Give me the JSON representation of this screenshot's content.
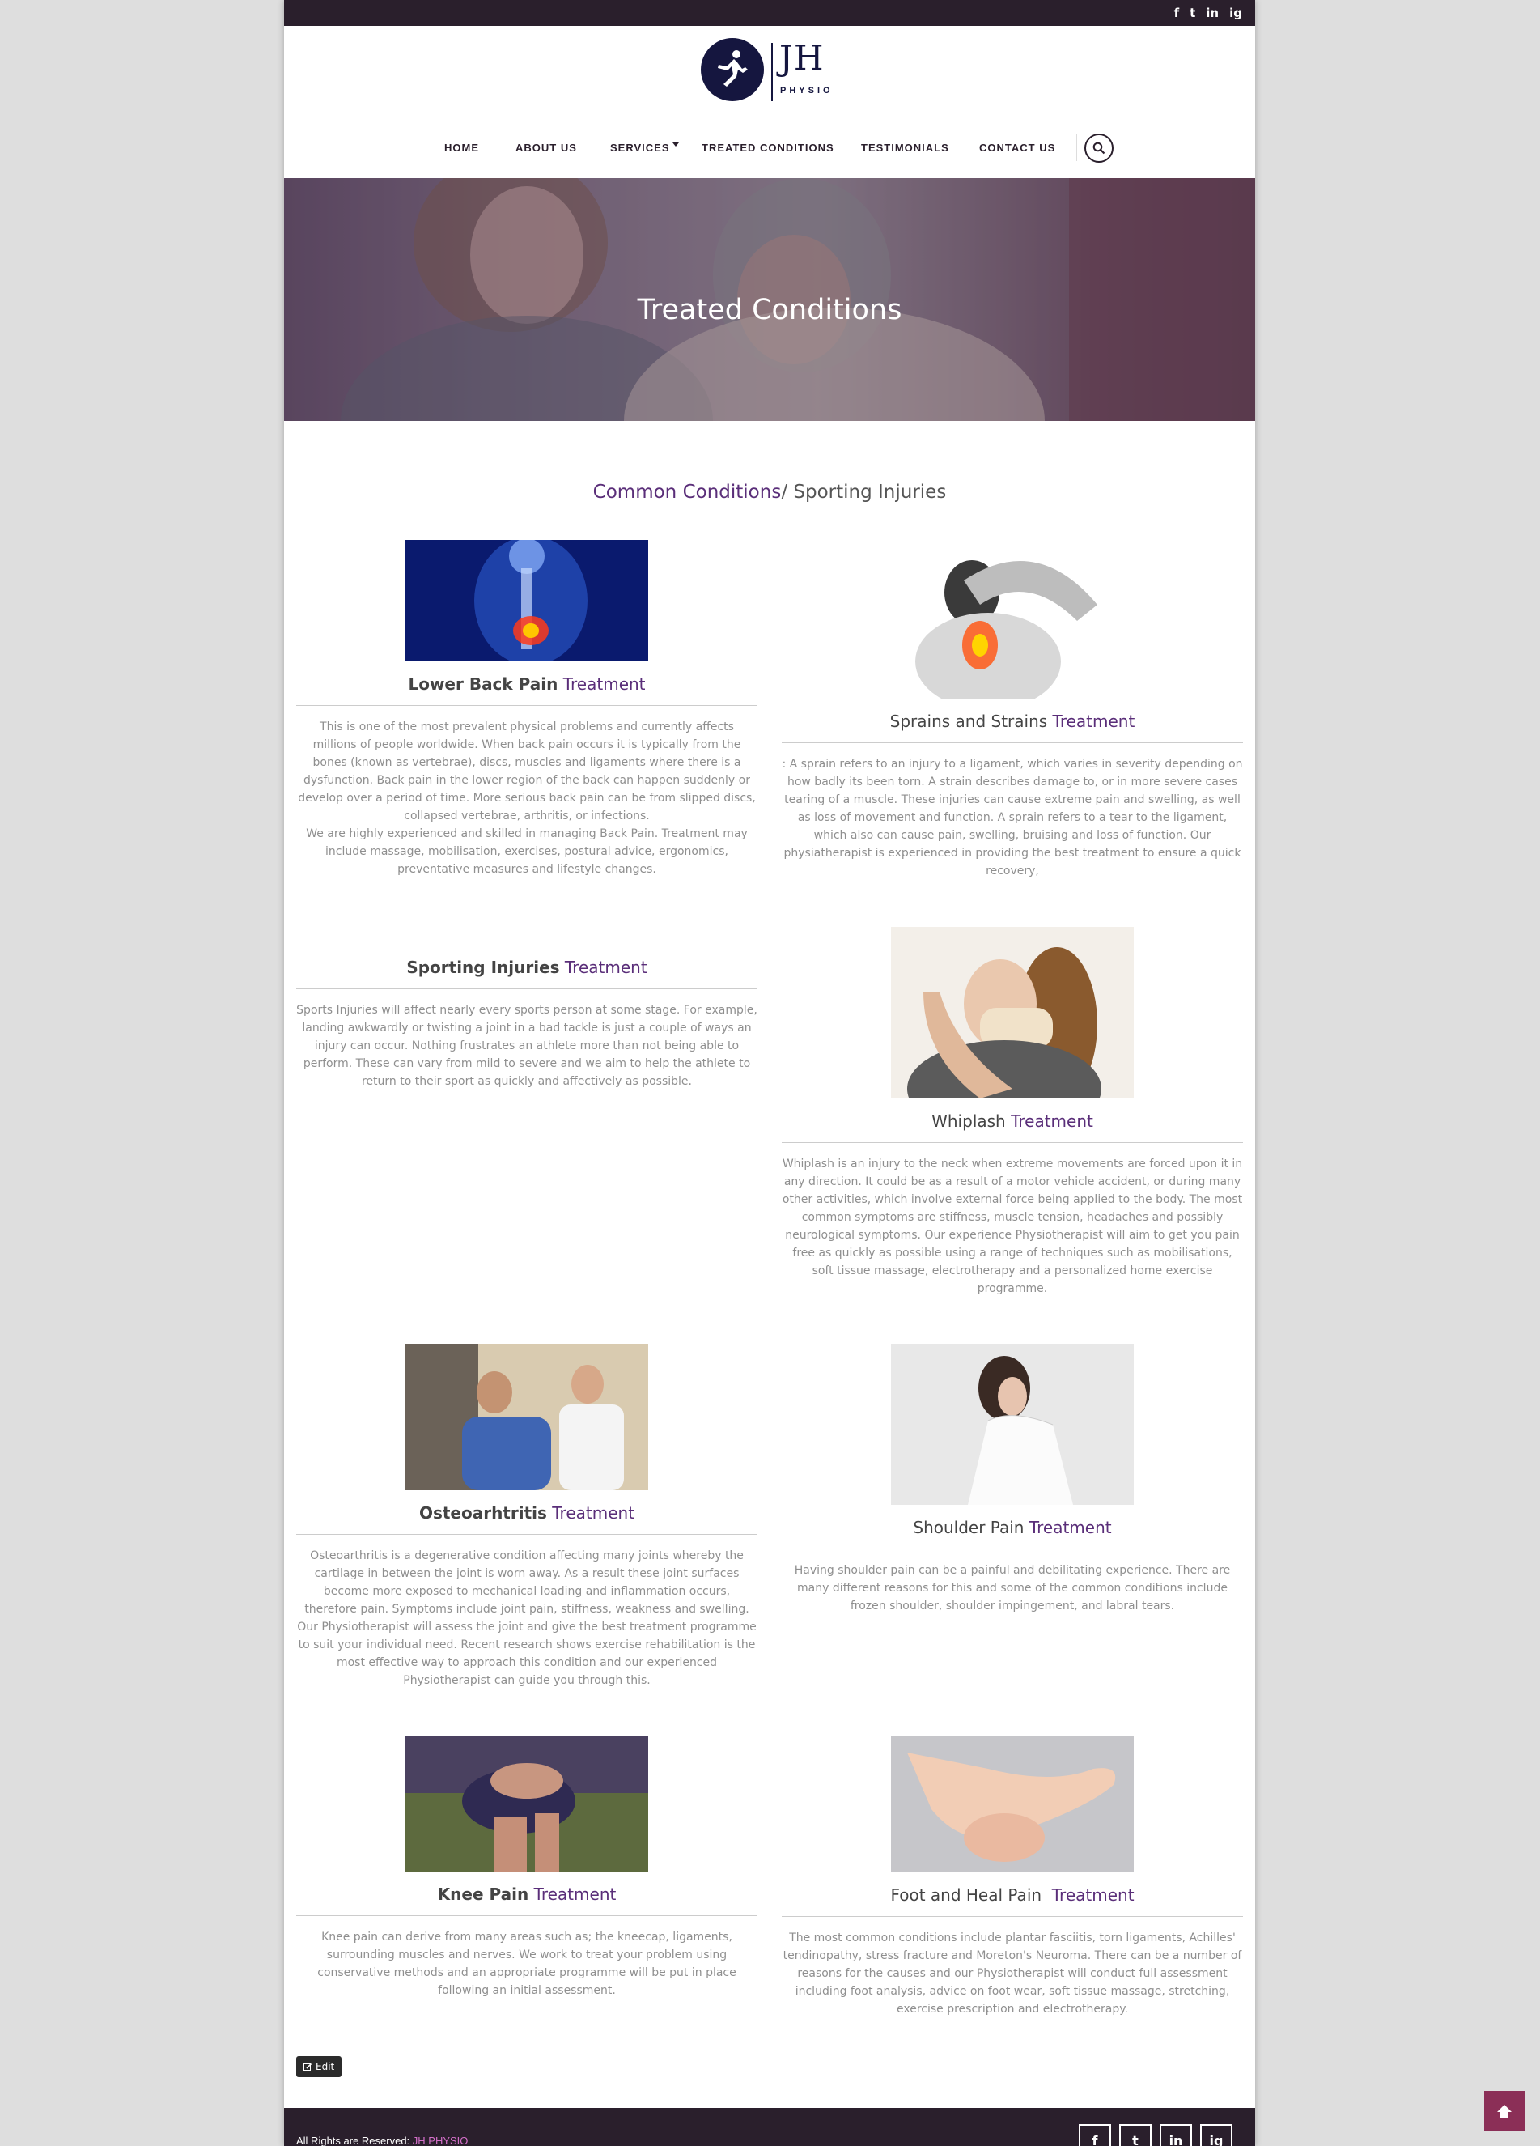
{
  "topbar": {
    "social": [
      "f",
      "t",
      "in",
      "ig"
    ]
  },
  "logo": {
    "jh": "JH",
    "physio": "PHYSIO"
  },
  "nav": {
    "home": "HOME",
    "about": "ABOUT US",
    "services": "SERVICES",
    "treated": "TREATED CONDITIONS",
    "testimonials": "TESTIMONIALS",
    "contact": "CONTACT US"
  },
  "hero": {
    "title": "Treated Conditions"
  },
  "section": {
    "accent": "Common Conditions",
    "rest": "/ Sporting Injuries"
  },
  "conditions": [
    {
      "name": "Lower Back Pain",
      "treatment": "Treatment",
      "desc": "This is one of the most prevalent physical problems and currently affects millions of people worldwide. When back pain occurs it is typically from the bones (known as vertebrae), discs, muscles and ligaments where there is a dysfunction. Back pain in the lower region of the back can happen suddenly or develop over a period of time. More serious back pain can be from slipped discs, collapsed vertebrae, arthritis, or infections.",
      "desc2": "We are highly experienced and skilled in managing Back Pain. Treatment may include massage, mobilisation, exercises, postural advice, ergonomics, preventative measures and lifestyle changes."
    },
    {
      "name": "Sprains and Strains",
      "treatment": "Treatment",
      "desc": ": A sprain refers to an injury to a ligament, which varies in severity depending on how badly its been torn. A strain describes damage to, or in more severe cases tearing of a muscle. These injuries can cause extreme pain and swelling, as well as loss of movement and function. A sprain refers to a tear to the ligament, which also can cause pain, swelling, bruising and loss of function. Our physiatherapist is experienced in providing the best treatment to ensure a quick recovery,"
    },
    {
      "name": "Sporting Injuries",
      "treatment": "Treatment",
      "desc": "Sports Injuries will affect nearly every sports person at some stage. For example, landing awkwardly or twisting a joint in a bad tackle is just a couple of ways an injury can occur. Nothing frustrates an athlete more than not being able to perform. These can vary from mild to severe and we aim to help the athlete to return to their sport as quickly and affectively as possible."
    },
    {
      "name": "Whiplash",
      "treatment": "Treatment",
      "desc": "Whiplash is an injury to the neck when extreme movements are forced upon it in any direction. It could be as a result of a motor vehicle accident, or during many other activities, which involve external force being applied to the body. The most common symptoms are stiffness, muscle tension, headaches and possibly neurological symptoms. Our experience Physiotherapist will aim to get you pain free as quickly as possible using a range of techniques such as mobilisations, soft tissue massage, electrotherapy and a personalized home exercise programme."
    },
    {
      "name": "Osteoarhtritis",
      "treatment": "Treatment",
      "desc": "Osteoarthritis is a degenerative condition affecting many joints whereby the cartilage in between the joint is worn away. As a result these joint surfaces become more exposed to mechanical loading and inflammation occurs, therefore pain. Symptoms include joint pain, stiffness, weakness and swelling. Our Physiotherapist will assess the joint and give the best treatment programme to suit your individual need. Recent research shows exercise rehabilitation is the most effective way to approach this condition and our experienced Physiotherapist can guide you through this."
    },
    {
      "name": "Shoulder Pain",
      "treatment": "Treatment",
      "desc": "Having shoulder pain can be a painful and debilitating experience. There are many different reasons for this and some of the common conditions include frozen shoulder, shoulder impingement, and labral tears."
    },
    {
      "name": "Knee Pain",
      "treatment": "Treatment",
      "desc": "Knee pain can derive from many areas such as; the kneecap, ligaments, surrounding muscles and nerves. We work to treat your problem using conservative methods and an appropriate programme will be put in place following an initial assessment."
    },
    {
      "name": "Foot and Heal Pain",
      "treatment": "Treatment",
      "desc": "The most common conditions include plantar fasciitis, torn ligaments, Achilles' tendinopathy, stress fracture and Moreton's Neuroma. There can be a number of reasons for the causes and our Physiotherapist will conduct full assessment including foot analysis, advice on foot wear, soft tissue massage, stretching, exercise prescription and electrotherapy."
    }
  ],
  "edit": {
    "label": "Edit"
  },
  "footer": {
    "copy": "All Rights are Reserved: ",
    "brand": "JH PHYSIO",
    "social": [
      "f",
      "t",
      "in",
      "ig"
    ]
  },
  "colors": {
    "accent": "#5a2e79",
    "dark": "#2a1f2c",
    "scrolltop": "#8b2f57"
  }
}
